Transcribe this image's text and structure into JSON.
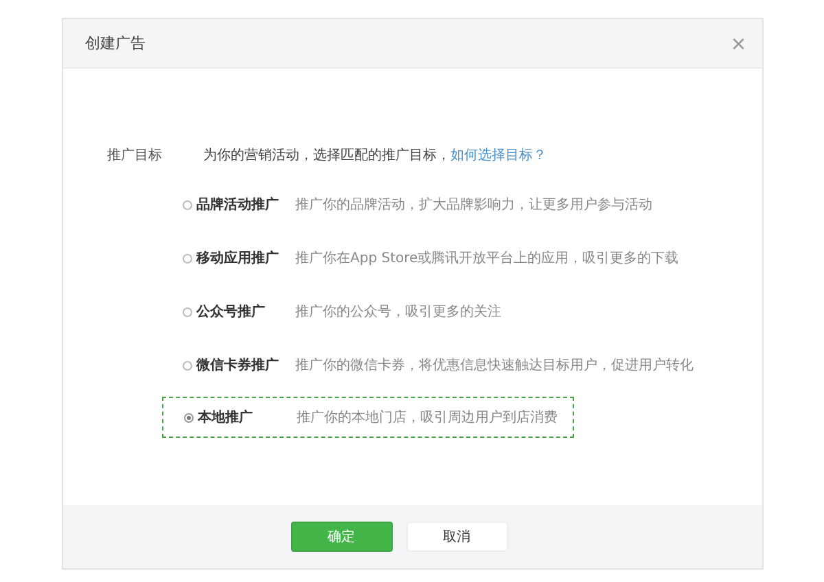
{
  "dialog": {
    "title": "创建广告",
    "close": "×"
  },
  "field": {
    "label": "推广目标",
    "intro": "为你的营销活动，选择匹配的推广目标，",
    "help_link": "如何选择目标？"
  },
  "options": [
    {
      "name": "品牌活动推广",
      "description": "推广你的品牌活动，扩大品牌影响力，让更多用户参与活动",
      "selected": false
    },
    {
      "name": "移动应用推广",
      "description": "推广你在App Store或腾讯开放平台上的应用，吸引更多的下载",
      "selected": false
    },
    {
      "name": "公众号推广",
      "description": "推广你的公众号，吸引更多的关注",
      "selected": false
    },
    {
      "name": "微信卡券推广",
      "description": "推广你的微信卡券，将优惠信息快速触达目标用户，促进用户转化",
      "selected": false
    },
    {
      "name": "本地推广",
      "description": "推广你的本地门店，吸引周边用户到店消费",
      "selected": true
    }
  ],
  "buttons": [
    {
      "label": "确定",
      "kind": "primary"
    },
    {
      "label": "取消",
      "kind": "secondary"
    }
  ]
}
